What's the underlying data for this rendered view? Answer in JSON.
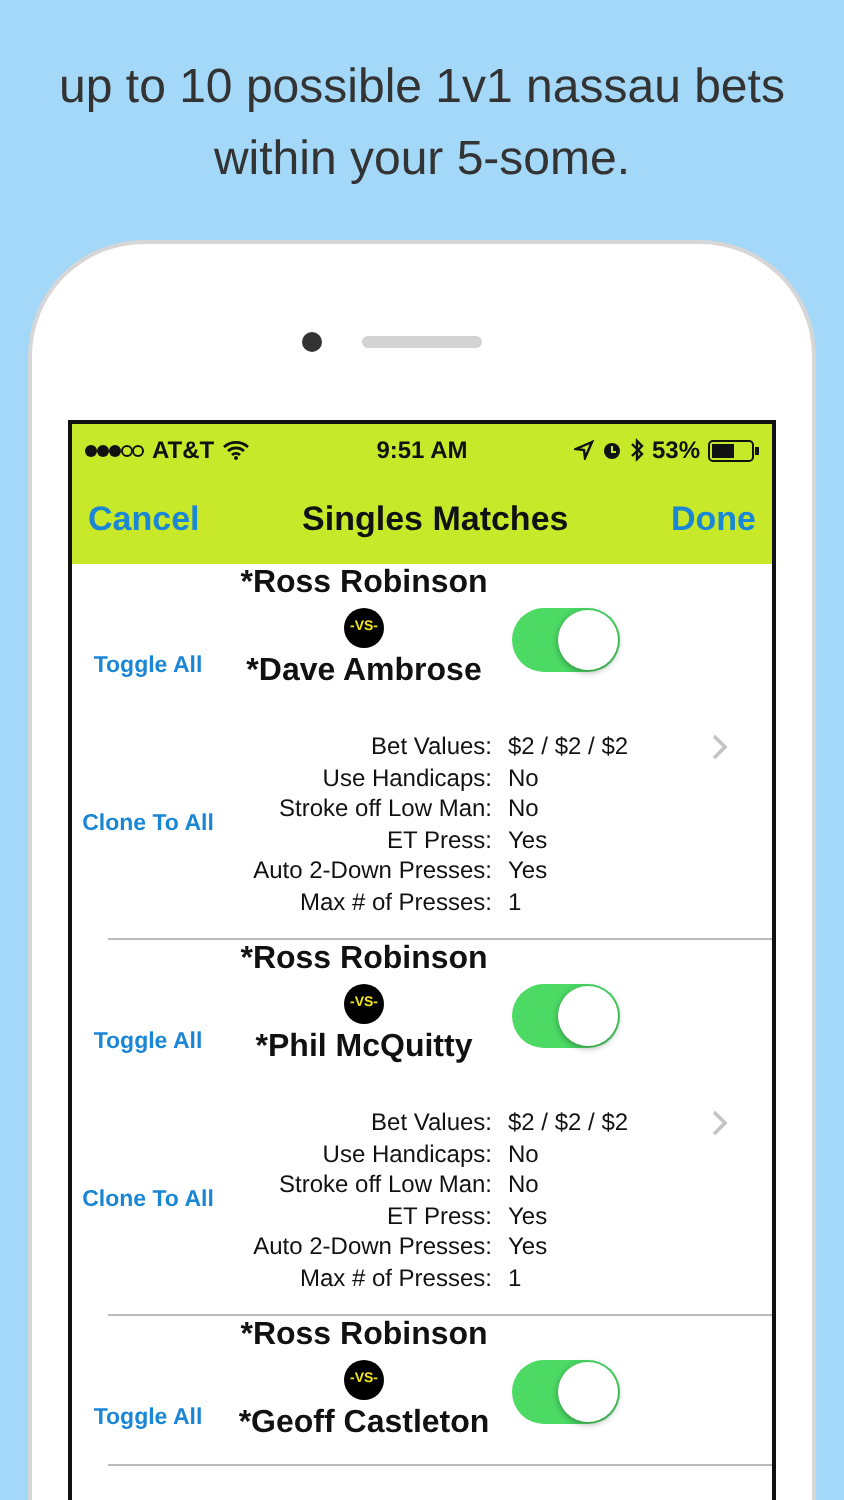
{
  "headline": "up to 10 possible 1v1 nassau bets within your 5-some.",
  "status_bar": {
    "carrier": "AT&T",
    "time": "9:51 AM",
    "battery": "53%"
  },
  "nav": {
    "left": "Cancel",
    "title": "Singles Matches",
    "right": "Done"
  },
  "matches": [
    {
      "player_1": "*Ross Robinson",
      "vs": "-VS-",
      "player_2": "*Dave Ambrose",
      "on": true,
      "toggle_all": "Toggle All",
      "clone_to_all": "Clone To All",
      "details": [
        {
          "label": "Bet Values:",
          "value": "$2 / $2 / $2"
        },
        {
          "label": "Use Handicaps:",
          "value": "No"
        },
        {
          "label": "Stroke off Low Man:",
          "value": "No"
        },
        {
          "label": "ET Press:",
          "value": "Yes"
        },
        {
          "label": "Auto 2-Down Presses:",
          "value": "Yes"
        },
        {
          "label": "Max # of Presses:",
          "value": "1"
        }
      ]
    },
    {
      "player_1": "*Ross Robinson",
      "vs": "-VS-",
      "player_2": "*Phil McQuitty",
      "on": true,
      "toggle_all": "Toggle All",
      "clone_to_all": "Clone To All",
      "details": [
        {
          "label": "Bet Values:",
          "value": "$2 / $2 / $2"
        },
        {
          "label": "Use Handicaps:",
          "value": "No"
        },
        {
          "label": "Stroke off Low Man:",
          "value": "No"
        },
        {
          "label": "ET Press:",
          "value": "Yes"
        },
        {
          "label": "Auto 2-Down Presses:",
          "value": "Yes"
        },
        {
          "label": "Max # of Presses:",
          "value": "1"
        }
      ]
    },
    {
      "player_1": "*Ross Robinson",
      "vs": "-VS-",
      "player_2": "*Geoff Castleton",
      "on": true,
      "toggle_all": "Toggle All"
    }
  ]
}
